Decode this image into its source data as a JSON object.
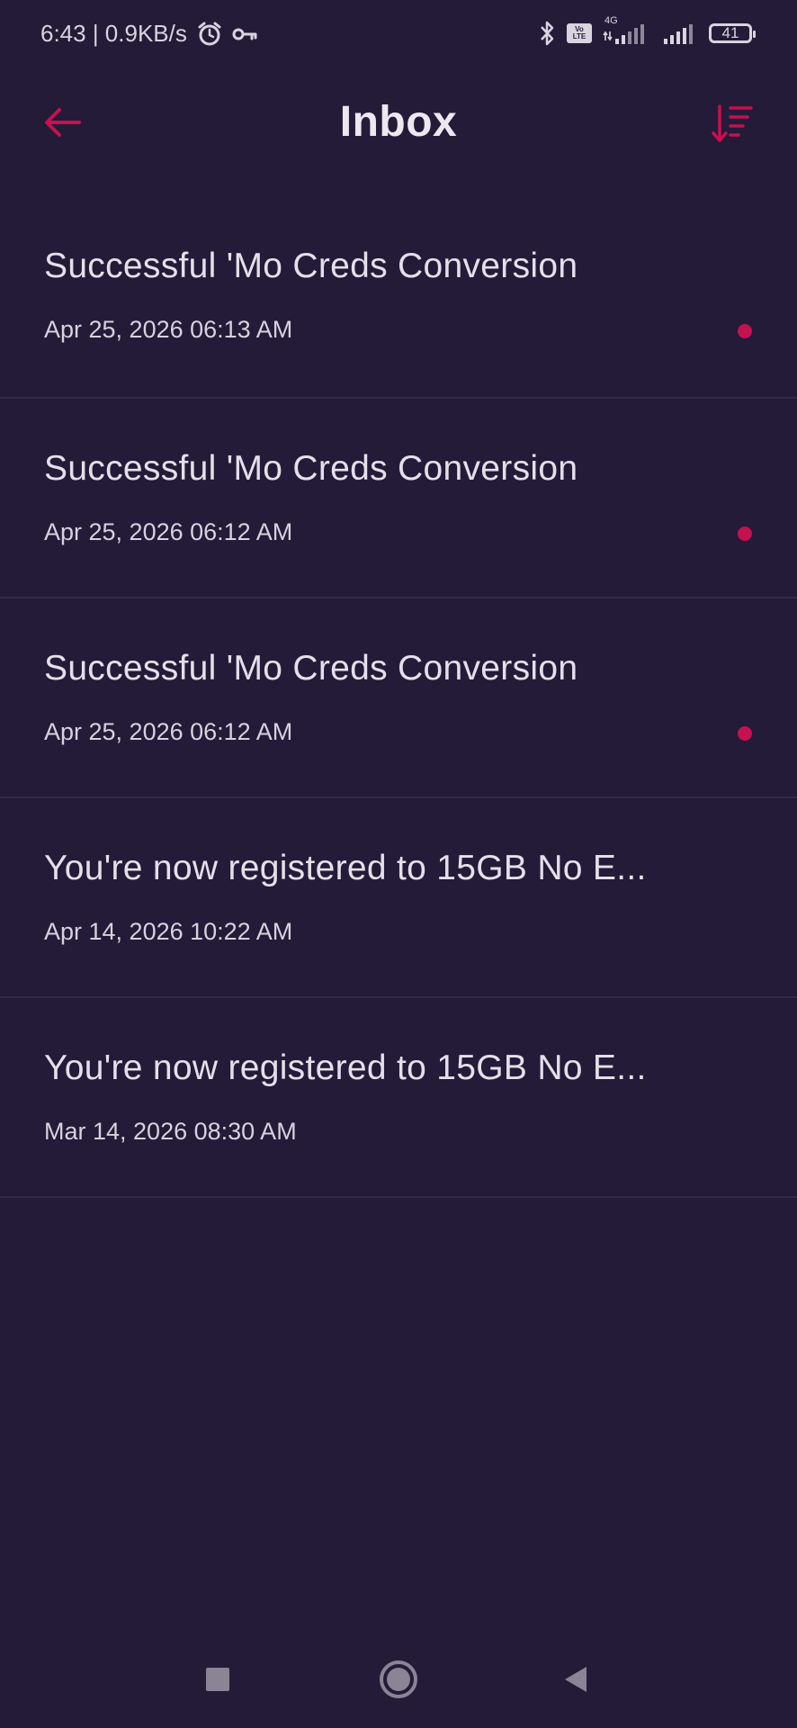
{
  "status_bar": {
    "time_speed": "6:43 | 0.9KB/s",
    "network_type": "4G",
    "volte_line1": "Vo",
    "volte_line2": "LTE",
    "battery": "41",
    "icons": [
      "alarm-icon",
      "key-icon",
      "bluetooth-icon",
      "volte-icon",
      "signal-icon",
      "signal-icon",
      "battery-icon"
    ]
  },
  "header": {
    "title": "Inbox",
    "back_icon": "arrow-left-icon",
    "sort_icon": "sort-descending-icon"
  },
  "colors": {
    "background": "#231b37",
    "accent": "#c4114f",
    "text": "#e4e0ea",
    "divider": "#322a47"
  },
  "messages": [
    {
      "title": "Successful 'Mo Creds Conversion",
      "date": "Apr 25, 2026 06:13 AM",
      "unread": true
    },
    {
      "title": "Successful 'Mo Creds Conversion",
      "date": "Apr 25, 2026 06:12 AM",
      "unread": true
    },
    {
      "title": "Successful 'Mo Creds Conversion",
      "date": "Apr 25, 2026 06:12 AM",
      "unread": true
    },
    {
      "title": "You're now registered to 15GB No E...",
      "date": "Apr 14, 2026 10:22 AM",
      "unread": false
    },
    {
      "title": "You're now registered to 15GB No E...",
      "date": "Mar 14, 2026 08:30 AM",
      "unread": false
    }
  ],
  "nav_bar": {
    "icons": [
      "recents-square-icon",
      "home-circle-icon",
      "back-triangle-icon"
    ]
  }
}
